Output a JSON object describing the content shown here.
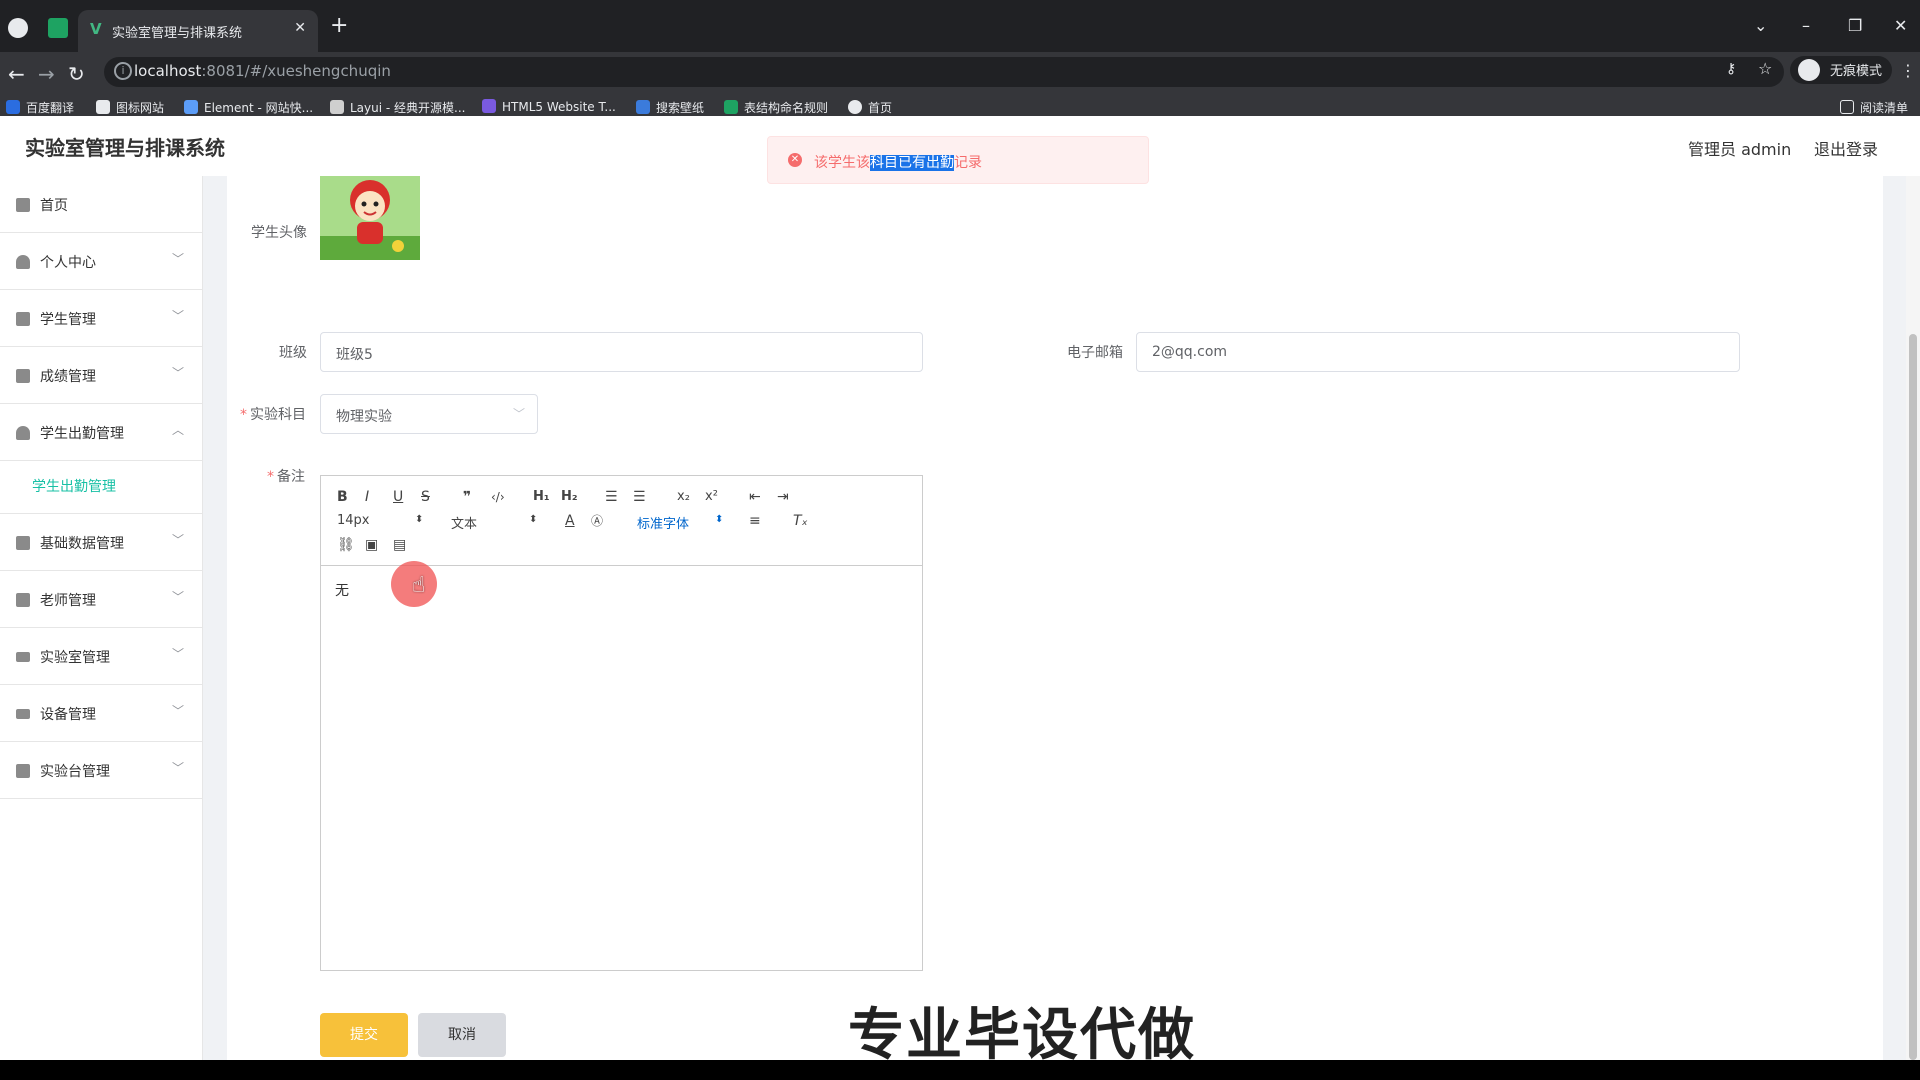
{
  "browser": {
    "tab_title": "实验室管理与排课系统",
    "tab_close": "✕",
    "new_tab": "+",
    "url_host": "localhost",
    "url_path": ":8081/#/xueshengchuqin",
    "incognito_label": "无痕模式",
    "reading_list": "阅读清单",
    "bookmarks": [
      "百度翻译",
      "图标网站",
      "Element - 网站快...",
      "Layui - 经典开源模...",
      "HTML5 Website T...",
      "搜索壁纸",
      "表结构命名规则",
      "首页"
    ]
  },
  "app": {
    "title": "实验室管理与排课系统",
    "user_label": "管理员 admin",
    "logout_label": "退出登录"
  },
  "sidebar": {
    "items": [
      {
        "label": "首页"
      },
      {
        "label": "个人中心"
      },
      {
        "label": "学生管理"
      },
      {
        "label": "成绩管理"
      },
      {
        "label": "学生出勤管理",
        "expanded": true,
        "sub": "学生出勤管理"
      },
      {
        "label": "基础数据管理"
      },
      {
        "label": "老师管理"
      },
      {
        "label": "实验室管理"
      },
      {
        "label": "设备管理"
      },
      {
        "label": "实验台管理"
      }
    ]
  },
  "form": {
    "avatar_label": "学生头像",
    "class_label": "班级",
    "class_value": "班级5",
    "email_label": "电子邮箱",
    "email_value": "2@qq.com",
    "subject_label": "实验科目",
    "subject_value": "物理实验",
    "remark_label": "备注",
    "editor": {
      "font_size": "14px",
      "format": "文本",
      "font_family": "标准字体",
      "content": "无"
    },
    "submit_label": "提交",
    "cancel_label": "取消"
  },
  "toast": {
    "prefix": "该学生该",
    "highlight": "科目已有出勤",
    "suffix": "记录"
  },
  "watermark": "专业毕设代做",
  "colors": {
    "accent": "#18c0a5",
    "submit": "#f7c13a",
    "error": "#f56c6c"
  }
}
